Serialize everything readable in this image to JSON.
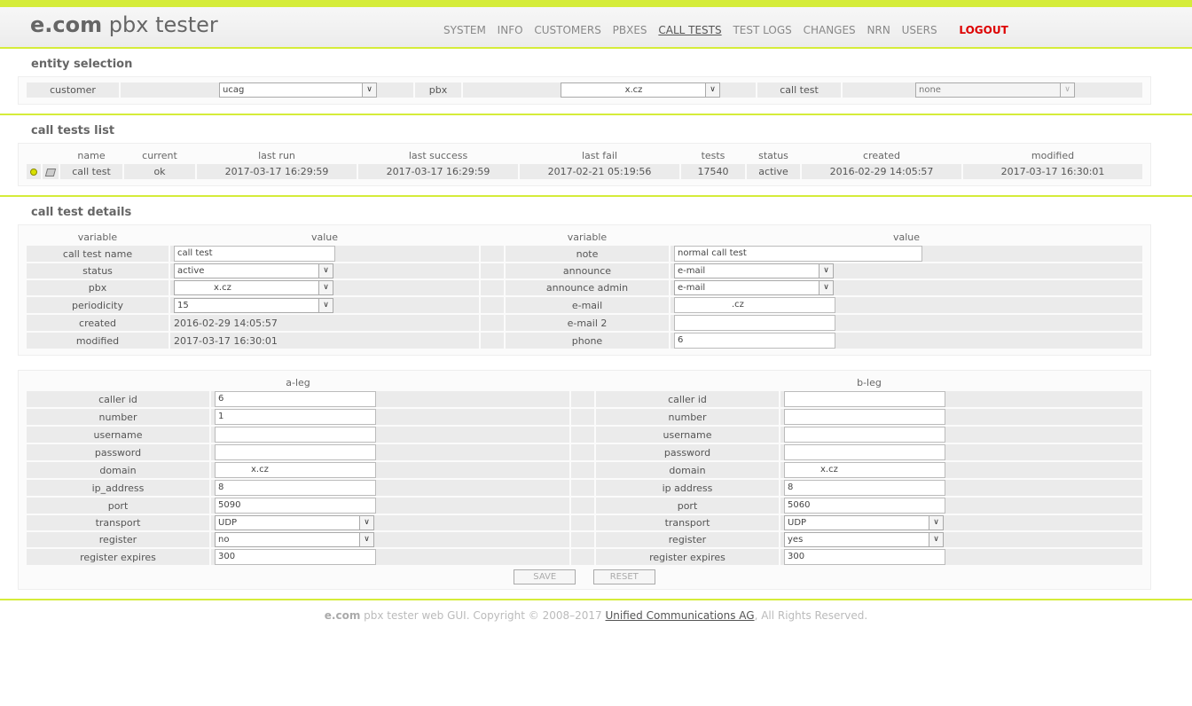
{
  "header": {
    "logo_brand": "e.com",
    "logo_rest": "pbx tester",
    "nav": [
      "SYSTEM",
      "INFO",
      "CUSTOMERS",
      "PBXES",
      "CALL TESTS",
      "TEST LOGS",
      "CHANGES",
      "NRN",
      "USERS"
    ],
    "active_nav": "CALL TESTS",
    "logout": "LOGOUT"
  },
  "entity_selection": {
    "title": "entity selection",
    "customer_label": "customer",
    "customer_value": "ucag",
    "pbx_label": "pbx",
    "pbx_value": "x.cz",
    "call_test_label": "call test",
    "call_test_value": "none"
  },
  "call_tests_list": {
    "title": "call tests list",
    "columns": [
      "name",
      "current",
      "last run",
      "last success",
      "last fail",
      "tests",
      "status",
      "created",
      "modified"
    ],
    "row": {
      "name": "call test",
      "current": "ok",
      "last_run": "2017-03-17 16:29:59",
      "last_success": "2017-03-17 16:29:59",
      "last_fail": "2017-02-21 05:19:56",
      "tests": "17540",
      "status": "active",
      "created": "2016-02-29 14:05:57",
      "modified": "2017-03-17 16:30:01"
    }
  },
  "details": {
    "title": "call test details",
    "col_variable": "variable",
    "col_value": "value",
    "call_test_name_label": "call test name",
    "call_test_name": "call test",
    "status_label": "status",
    "status": "active",
    "pbx_label": "pbx",
    "pbx": "x.cz",
    "periodicity_label": "periodicity",
    "periodicity": "15",
    "created_label": "created",
    "created": "2016-02-29 14:05:57",
    "modified_label": "modified",
    "modified": "2017-03-17 16:30:01",
    "note_label": "note",
    "note": "normal call test",
    "announce_label": "announce",
    "announce": "e-mail",
    "announce_admin_label": "announce admin",
    "announce_admin": "e-mail",
    "email_label": "e-mail",
    "email": ".cz",
    "email2_label": "e-mail 2",
    "email2": "",
    "phone_label": "phone",
    "phone": "6"
  },
  "legs": {
    "a_title": "a-leg",
    "b_title": "b-leg",
    "labels": {
      "caller_id": "caller id",
      "number": "number",
      "username": "username",
      "password": "password",
      "domain": "domain",
      "ip_address": "ip_address",
      "ip_address_b": "ip address",
      "port": "port",
      "transport": "transport",
      "register": "register",
      "register_expires": "register expires"
    },
    "a": {
      "caller_id": "6",
      "number": "1",
      "username": "",
      "password": "",
      "domain": "x.cz",
      "ip_address": "8",
      "port": "5090",
      "transport": "UDP",
      "register": "no",
      "register_expires": "300"
    },
    "b": {
      "caller_id": "",
      "number": "",
      "username": "",
      "password": "",
      "domain": "x.cz",
      "ip_address": "8",
      "port": "5060",
      "transport": "UDP",
      "register": "yes",
      "register_expires": "300"
    },
    "save": "SAVE",
    "reset": "RESET"
  },
  "footer": {
    "brand": "e.com",
    "text": " pbx tester web GUI. Copyright © 2008–2017 ",
    "link": "Unified Communications AG",
    "rights": ", All Rights Reserved."
  },
  "icons": {
    "status": "bulb-icon",
    "edit": "edit-icon",
    "dropdown": "chevron-down-icon"
  }
}
